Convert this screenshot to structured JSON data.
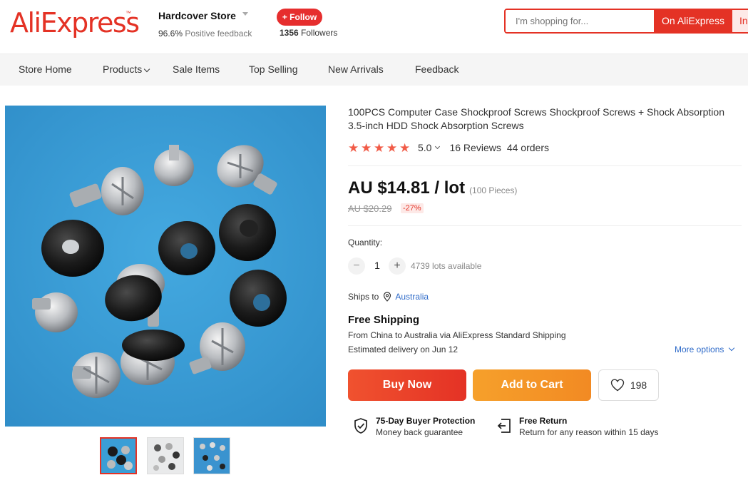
{
  "header": {
    "logo_text": "AliExpress",
    "logo_tm": "™",
    "store_name": "Hardcover Store",
    "positive_pct": "96.6%",
    "positive_label": "Positive feedback",
    "follow_label": "+ Follow",
    "followers_count": "1356",
    "followers_label": "Followers",
    "search_placeholder": "I'm shopping for...",
    "search_button": "On AliExpress",
    "search_button2": "In"
  },
  "nav": {
    "items": [
      {
        "label": "Store Home"
      },
      {
        "label": "Products"
      },
      {
        "label": "Sale Items"
      },
      {
        "label": "Top Selling"
      },
      {
        "label": "New Arrivals"
      },
      {
        "label": "Feedback"
      }
    ]
  },
  "product": {
    "title": "100PCS Computer Case Shockproof Screws Shockproof Screws + Shock Absorption 3.5-inch HDD Shock Absorption Screws",
    "rating": "5.0",
    "stars": 5,
    "reviews": "16 Reviews",
    "orders": "44 orders",
    "price": "AU $14.81 / lot",
    "price_unit": "(100 Pieces)",
    "old_price": "AU $20.29",
    "discount": "-27%",
    "quantity_label": "Quantity:",
    "quantity": "1",
    "available": "4739 lots available",
    "ships_to_label": "Ships to",
    "ships_to_country": "Australia",
    "shipping_title": "Free Shipping",
    "shipping_from": "From China to Australia via AliExpress Standard Shipping",
    "estimated_delivery": "Estimated delivery on Jun 12",
    "more_options": "More options",
    "buy_now": "Buy Now",
    "add_to_cart": "Add to Cart",
    "wishlist_count": "198"
  },
  "guarantees": [
    {
      "title": "75-Day Buyer Protection",
      "subtitle": "Money back guarantee",
      "icon": "shield-check-icon"
    },
    {
      "title": "Free Return",
      "subtitle": "Return for any reason within 15 days",
      "icon": "return-icon"
    }
  ],
  "colors": {
    "brand": "#e43225",
    "buy_now": "#e8452c",
    "add_to_cart": "#f39324",
    "link": "#2f6bc9",
    "star": "#f15b47",
    "image_background": "#3a9ed6"
  }
}
